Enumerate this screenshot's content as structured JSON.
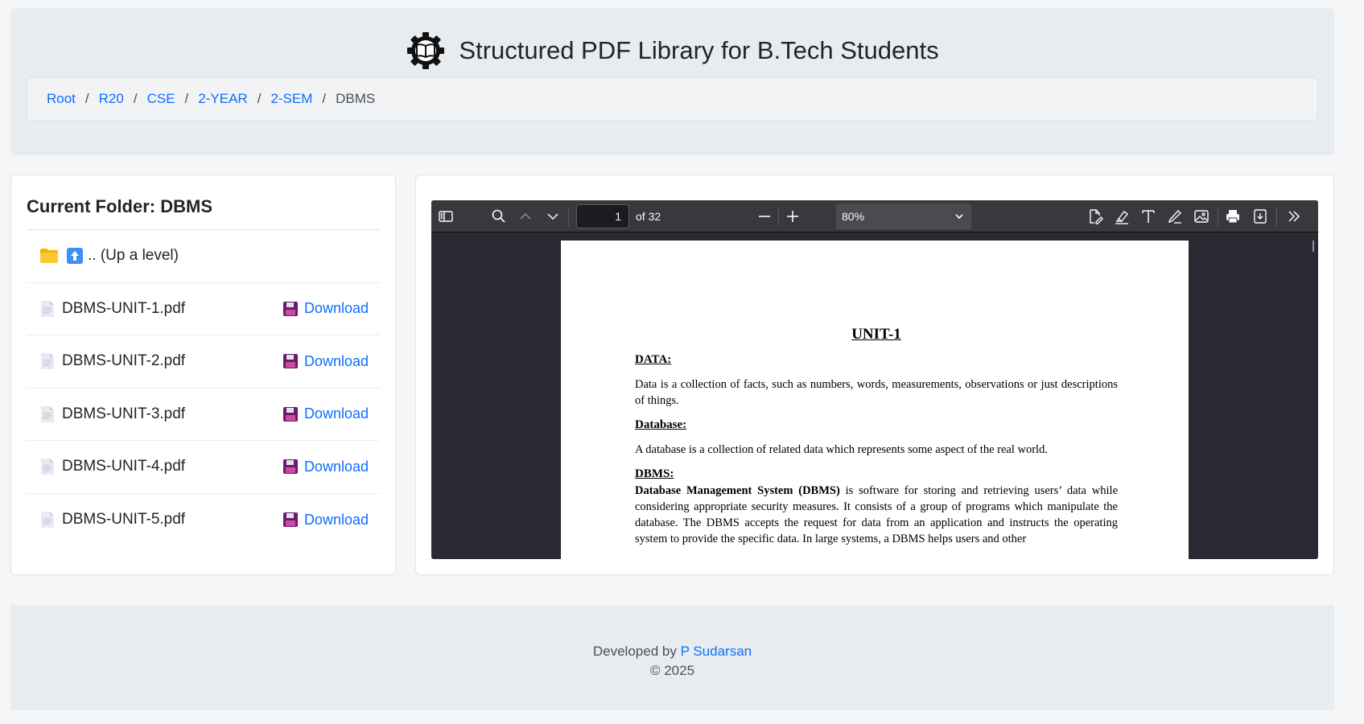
{
  "header": {
    "title": "Structured PDF Library for B.Tech Students",
    "logo_icon": "gear-book-icon"
  },
  "breadcrumb": {
    "items": [
      "Root",
      "R20",
      "CSE",
      "2-YEAR",
      "2-SEM"
    ],
    "separator": "/",
    "current": "DBMS"
  },
  "sidebar": {
    "heading": "Current Folder: DBMS",
    "up_item": {
      "label": ".. (Up a level)",
      "icons": [
        "folder-icon",
        "up-arrow-icon"
      ]
    },
    "files": [
      {
        "name": "DBMS-UNIT-1.pdf",
        "action": "Download"
      },
      {
        "name": "DBMS-UNIT-2.pdf",
        "action": "Download"
      },
      {
        "name": "DBMS-UNIT-3.pdf",
        "action": "Download"
      },
      {
        "name": "DBMS-UNIT-4.pdf",
        "action": "Download"
      },
      {
        "name": "DBMS-UNIT-5.pdf",
        "action": "Download"
      }
    ]
  },
  "viewer": {
    "page_number": "1",
    "page_count": "of 32",
    "zoom": "80%",
    "toolbar_icons": [
      "sidebar-toggle-icon",
      "search-icon",
      "previous-page-icon",
      "next-page-icon",
      "zoom-out-icon",
      "zoom-in-icon",
      "edit-pdf-icon",
      "highlight-icon",
      "text-icon",
      "draw-icon",
      "image-icon",
      "print-icon",
      "save-icon",
      "more-tools-icon"
    ],
    "document": {
      "title": "UNIT-1",
      "data_heading": "DATA:",
      "data_text": "Data is a collection of facts, such as numbers, words, measurements, observations or just descriptions of things.",
      "database_heading": "Database:",
      "database_text": "A database is a collection of related data which represents some aspect of the real world.",
      "dbms_heading": "DBMS:",
      "dbms_bold": "Database Management System (DBMS)",
      "dbms_text": " is software for storing and retrieving users’ data while considering appropriate security measures. It consists of a group of programs which manipulate the database. The DBMS accepts the request for data from an application and instructs the operating system to provide the specific data. In large systems, a DBMS helps users and other"
    }
  },
  "footer": {
    "developed_by": "Developed by",
    "author": "P Sudarsan",
    "copyright": "© 2025"
  },
  "colors": {
    "link": "#0d6efd",
    "header_bg": "#e9ecef",
    "viewer_bg": "#2b2a33",
    "toolbar_bg": "#38383d"
  }
}
